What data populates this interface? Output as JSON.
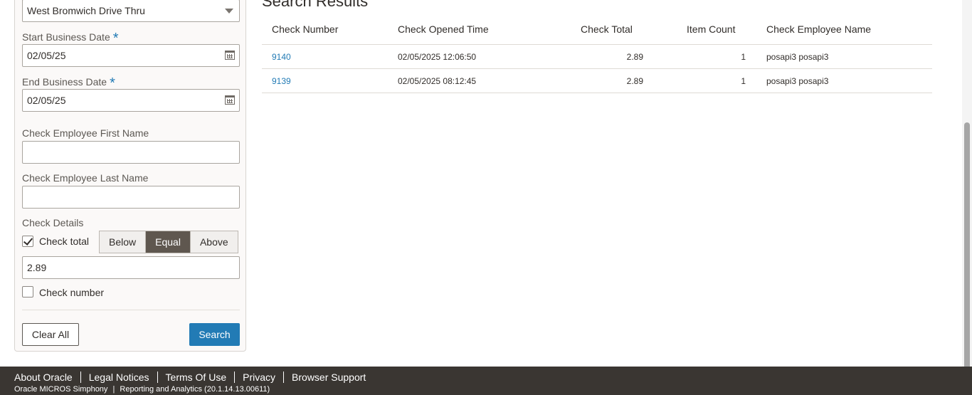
{
  "filters": {
    "location_value": "West Bromwich Drive Thru",
    "start_date_label": "Start Business Date",
    "start_date_value": "02/05/25",
    "end_date_label": "End Business Date",
    "end_date_value": "02/05/25",
    "required_mark": "*",
    "emp_first_label": "Check Employee First Name",
    "emp_first_value": "",
    "emp_last_label": "Check Employee Last Name",
    "emp_last_value": "",
    "details_label": "Check Details",
    "check_total_label": "Check total",
    "check_total_checked": true,
    "compare_options": [
      "Below",
      "Equal",
      "Above"
    ],
    "compare_selected": "Equal",
    "check_total_value": "2.89",
    "check_number_label": "Check number",
    "check_number_checked": false,
    "clear_label": "Clear All",
    "search_label": "Search"
  },
  "results": {
    "title": "Search Results",
    "columns": [
      "Check Number",
      "Check Opened Time",
      "Check Total",
      "Item Count",
      "Check Employee Name"
    ],
    "rows": [
      {
        "number": "9140",
        "opened": "02/05/2025 12:06:50",
        "total": "2.89",
        "items": "1",
        "employee": "posapi3 posapi3"
      },
      {
        "number": "9139",
        "opened": "02/05/2025 08:12:45",
        "total": "2.89",
        "items": "1",
        "employee": "posapi3 posapi3"
      }
    ]
  },
  "footer": {
    "links": [
      "About Oracle",
      "Legal Notices",
      "Terms Of Use",
      "Privacy",
      "Browser Support"
    ],
    "product": "Oracle MICROS Simphony",
    "sep": "|",
    "app": "Reporting and Analytics (20.1.14.13.00611)"
  },
  "colors": {
    "accent": "#227bb5",
    "footer_bg": "#3a3632",
    "segment_active": "#5f574f"
  }
}
